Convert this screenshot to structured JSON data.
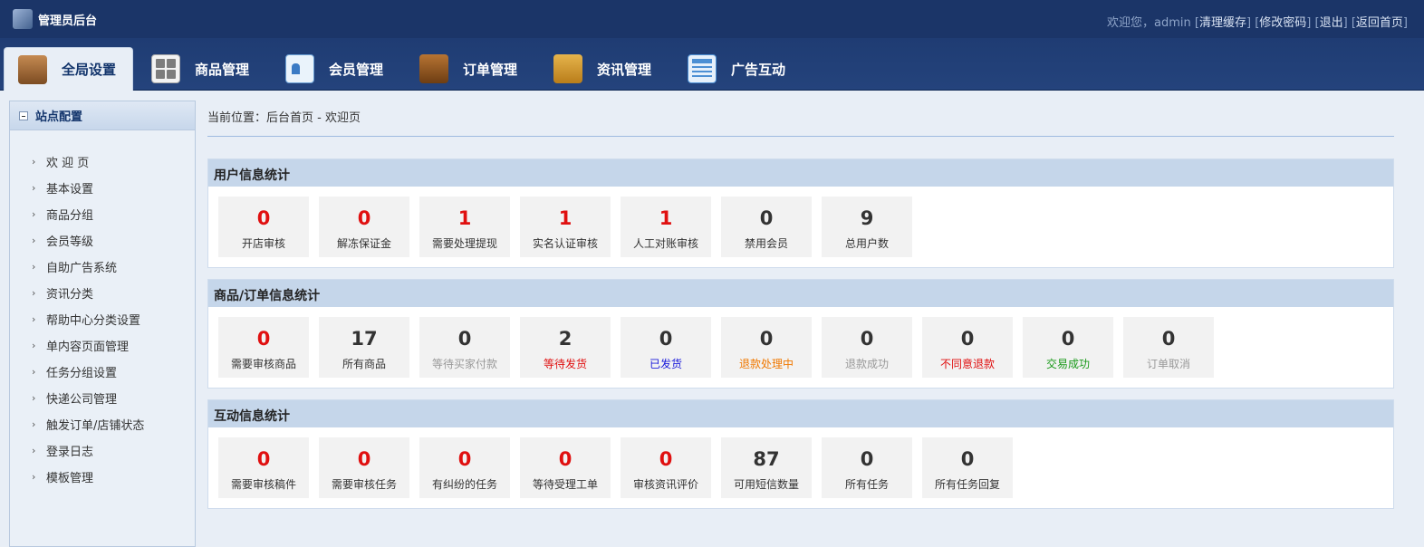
{
  "header": {
    "brand": "管理员后台",
    "welcome": "欢迎您，admin",
    "links": [
      "清理缓存",
      "修改密码",
      "退出",
      "返回首页"
    ]
  },
  "nav": {
    "tabs": [
      {
        "label": "全局设置",
        "icon": "gear-icon",
        "active": true
      },
      {
        "label": "商品管理",
        "icon": "grid-icon",
        "active": false
      },
      {
        "label": "会员管理",
        "icon": "member-icon",
        "active": false
      },
      {
        "label": "订单管理",
        "icon": "wallet-icon",
        "active": false
      },
      {
        "label": "资讯管理",
        "icon": "news-icon",
        "active": false
      },
      {
        "label": "广告互动",
        "icon": "ads-icon",
        "active": false
      }
    ]
  },
  "sidebar": {
    "title": "站点配置",
    "items": [
      "欢 迎 页",
      "基本设置",
      "商品分组",
      "会员等级",
      "自助广告系统",
      "资讯分类",
      "帮助中心分类设置",
      "单内容页面管理",
      "任务分组设置",
      "快递公司管理",
      "触发订单/店铺状态",
      "登录日志",
      "模板管理"
    ]
  },
  "breadcrumb": "当前位置：后台首页 - 欢迎页",
  "sections": [
    {
      "title": "用户信息统计",
      "cards": [
        {
          "value": "0",
          "label": "开店审核",
          "value_color": "#e01010",
          "label_color": "#333333"
        },
        {
          "value": "0",
          "label": "解冻保证金",
          "value_color": "#e01010",
          "label_color": "#333333"
        },
        {
          "value": "1",
          "label": "需要处理提现",
          "value_color": "#e01010",
          "label_color": "#333333"
        },
        {
          "value": "1",
          "label": "实名认证审核",
          "value_color": "#e01010",
          "label_color": "#333333"
        },
        {
          "value": "1",
          "label": "人工对账审核",
          "value_color": "#e01010",
          "label_color": "#333333"
        },
        {
          "value": "0",
          "label": "禁用会员",
          "value_color": "#333333",
          "label_color": "#333333"
        },
        {
          "value": "9",
          "label": "总用户数",
          "value_color": "#333333",
          "label_color": "#333333"
        }
      ]
    },
    {
      "title": "商品/订单信息统计",
      "cards": [
        {
          "value": "0",
          "label": "需要审核商品",
          "value_color": "#e01010",
          "label_color": "#333333"
        },
        {
          "value": "17",
          "label": "所有商品",
          "value_color": "#333333",
          "label_color": "#333333"
        },
        {
          "value": "0",
          "label": "等待买家付款",
          "value_color": "#333333",
          "label_color": "#999999"
        },
        {
          "value": "2",
          "label": "等待发货",
          "value_color": "#333333",
          "label_color": "#e01010"
        },
        {
          "value": "0",
          "label": "已发货",
          "value_color": "#333333",
          "label_color": "#1a1adb"
        },
        {
          "value": "0",
          "label": "退款处理中",
          "value_color": "#333333",
          "label_color": "#f07800"
        },
        {
          "value": "0",
          "label": "退款成功",
          "value_color": "#333333",
          "label_color": "#999999"
        },
        {
          "value": "0",
          "label": "不同意退款",
          "value_color": "#333333",
          "label_color": "#e01010"
        },
        {
          "value": "0",
          "label": "交易成功",
          "value_color": "#333333",
          "label_color": "#1a9a1a"
        },
        {
          "value": "0",
          "label": "订单取消",
          "value_color": "#333333",
          "label_color": "#999999"
        }
      ]
    },
    {
      "title": "互动信息统计",
      "cards": [
        {
          "value": "0",
          "label": "需要审核稿件",
          "value_color": "#e01010",
          "label_color": "#333333"
        },
        {
          "value": "0",
          "label": "需要审核任务",
          "value_color": "#e01010",
          "label_color": "#333333"
        },
        {
          "value": "0",
          "label": "有纠纷的任务",
          "value_color": "#e01010",
          "label_color": "#333333"
        },
        {
          "value": "0",
          "label": "等待受理工单",
          "value_color": "#e01010",
          "label_color": "#333333"
        },
        {
          "value": "0",
          "label": "审核资讯评价",
          "value_color": "#e01010",
          "label_color": "#333333"
        },
        {
          "value": "87",
          "label": "可用短信数量",
          "value_color": "#333333",
          "label_color": "#333333"
        },
        {
          "value": "0",
          "label": "所有任务",
          "value_color": "#333333",
          "label_color": "#333333"
        },
        {
          "value": "0",
          "label": "所有任务回复",
          "value_color": "#333333",
          "label_color": "#333333"
        }
      ]
    }
  ]
}
